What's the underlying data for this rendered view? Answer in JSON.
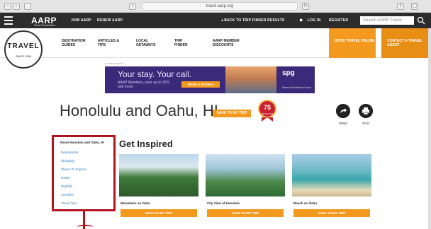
{
  "browser": {
    "url": "travel.aarp.org"
  },
  "header": {
    "logo": "AARP",
    "logo_sub": "Real Possibilities",
    "join": "JOIN AARP",
    "renew": "RENEW AARP",
    "back": "◂ BACK TO TRIP FINDER RESULTS",
    "login": "LOG IN",
    "register": "REGISTER",
    "search_placeholder": "Search AARP Travel"
  },
  "travel_logo": {
    "title": "TRAVEL",
    "sub": "SINCE 1958"
  },
  "subnav": [
    {
      "label": "DESTINATION GUIDES"
    },
    {
      "label": "ARTICLES & TIPS"
    },
    {
      "label": "LOCAL GETAWAYS"
    },
    {
      "label": "TRIP FINDER"
    },
    {
      "label": "AARP MEMBER DISCOUNTS"
    }
  ],
  "orange_tabs": [
    {
      "label": "BOOK TRAVEL ONLINE"
    },
    {
      "label": "CONTACT A TRAVEL AGENT"
    }
  ],
  "ad": {
    "label": "ADVERTISEMENT",
    "headline": "Your stay. Your call.",
    "subline": "AARP Members, save up to 15% and more.",
    "cta": "BOOK A ROOM ▸",
    "brand": "spg",
    "brand_sub": "Starwood Preferred Guest"
  },
  "page": {
    "title": "Honolulu and Oahu, HI",
    "save_button": "SAVE TO MY TRIP",
    "badge_number": "75",
    "badge_text": "SINCE 1940",
    "share": "Share",
    "print": "Print"
  },
  "sidebar": {
    "items": [
      "About Honolulu and Oahu, HI",
      "Restaurants",
      "Shopping",
      "Places To Explore",
      "Hotels",
      "Nightlife",
      "Activities",
      "Travel Tips"
    ]
  },
  "inspired": {
    "heading": "Get Inspired",
    "cards": [
      {
        "caption": "Mountains on Oahu",
        "button": "SAVE TO MY TRIP"
      },
      {
        "caption": "City View of Honolulu",
        "button": "SAVE TO MY TRIP"
      },
      {
        "caption": "Beach on Oahu",
        "button": "SAVE TO MY TRIP"
      }
    ]
  },
  "colors": {
    "accent": "#f39a1e",
    "header": "#2c2c2c",
    "highlight": "#b0141e",
    "link": "#2a7ec3"
  }
}
